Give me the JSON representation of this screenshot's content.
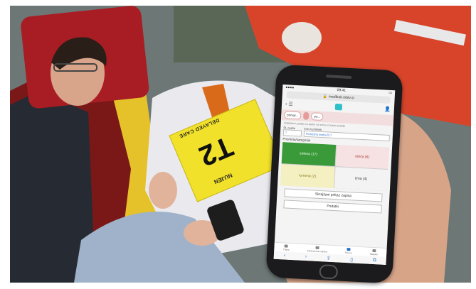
{
  "triage_tag": {
    "line1": "DELAYED CARE",
    "code": "T2",
    "line2": "NUJEN"
  },
  "phone": {
    "status_time": "09:41",
    "url": "medibok.mbtv.si",
    "nav_pills": [
      "primar...",
      "",
      "po..."
    ],
    "tiny_caption": "Zabeleženi podatki za osebe na terenu in triažni podatki",
    "field_1_label": "Št. osebe",
    "field_1_value": "7",
    "field_2_label": "Ime in priimek",
    "field_2_value": "Pomožna oseba št.7",
    "section_label": "Prioriteta/kategorija",
    "categories": [
      {
        "label": "zelena (17)",
        "color": "green"
      },
      {
        "label": "rdeča (6)",
        "color": "red"
      },
      {
        "label": "rumena (2)",
        "color": "yellow"
      },
      {
        "label": "črna (4)",
        "color": "white"
      }
    ],
    "button_1": "Skrajšani prikaz zapisa",
    "button_2": "Podatki",
    "tabs": [
      "Triaža",
      "Zdravstvena oskrba",
      "Prevoz",
      "Napotki"
    ]
  }
}
